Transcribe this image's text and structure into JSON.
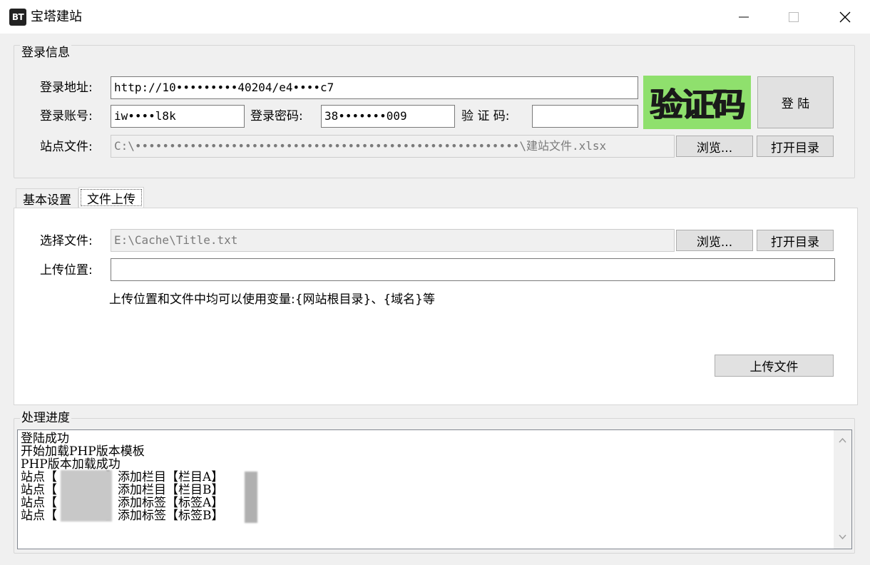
{
  "window": {
    "icon_text": "BT",
    "title": "宝塔建站",
    "minimize_icon": "minimize-icon",
    "maximize_icon": "maximize-icon",
    "close_icon": "close-icon"
  },
  "login": {
    "group_label": "登录信息",
    "url_label": "登录地址:",
    "url_value": "http://10•••••••••40204/e4••••c7",
    "account_label": "登录账号:",
    "account_value": "iw••••l8k",
    "password_label": "登录密码:",
    "password_value": "38•••••••009",
    "captcha_label": "验 证 码:",
    "captcha_value": "",
    "captcha_image_text": "验证码",
    "login_button": "登 陆",
    "site_file_label": "站点文件:",
    "site_file_value": "C:\\••••••••••••••••••••••••••••••••••••••••••••••••••••••••\\建站文件.xlsx",
    "browse_button": "浏览...",
    "open_dir_button": "打开目录"
  },
  "tabs": [
    {
      "label": "基本设置",
      "active": false
    },
    {
      "label": "文件上传",
      "active": true
    }
  ],
  "upload": {
    "select_file_label": "选择文件:",
    "select_file_value": "E:\\Cache\\Title.txt",
    "browse_button": "浏览...",
    "open_dir_button": "打开目录",
    "position_label": "上传位置:",
    "position_value": "",
    "hint": "上传位置和文件中均可以使用变量:{网站根目录}、{域名}等",
    "upload_button": "上传文件"
  },
  "progress": {
    "group_label": "处理进度",
    "lines": [
      "登陆成功",
      "开始加载PHP版本模板",
      "PHP版本加载成功",
      "站点【　　　　】添加栏目【栏目A】",
      "站点【　　　　】添加栏目【栏目B】",
      "站点【　　　　】添加标签【标签A】",
      "站点【　　　　】添加标签【标签B】"
    ],
    "scroll_up_icon": "chevron-up-icon",
    "scroll_down_icon": "chevron-down-icon"
  }
}
